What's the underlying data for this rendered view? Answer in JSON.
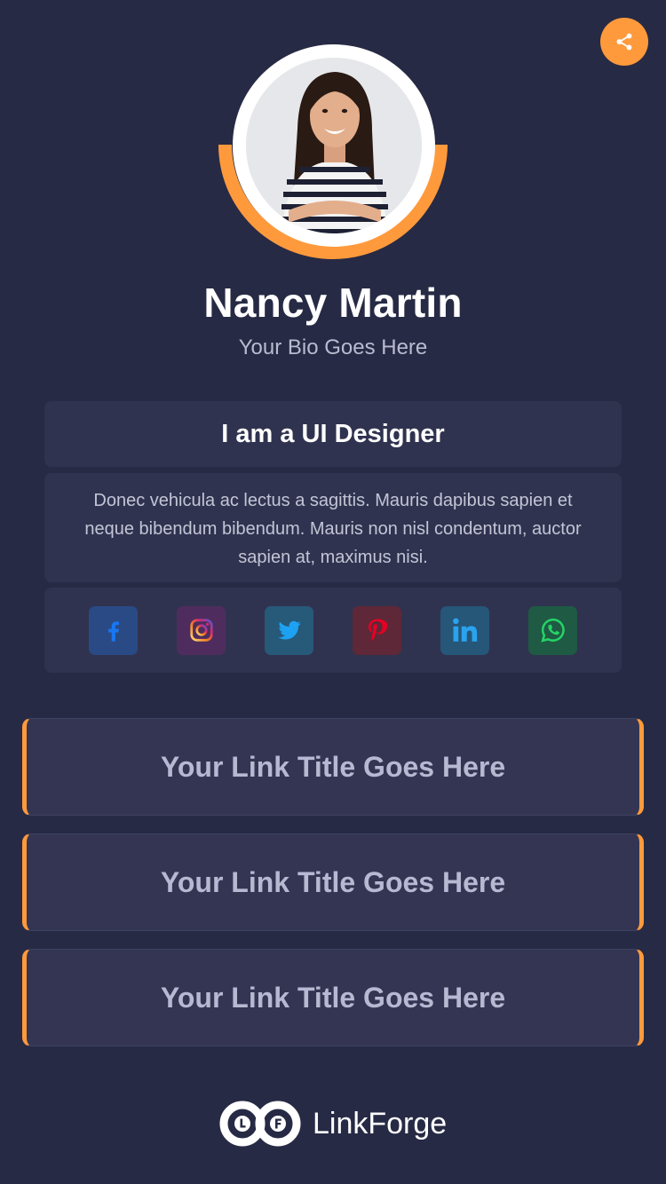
{
  "profile": {
    "name": "Nancy Martin",
    "bio": "Your Bio Goes Here"
  },
  "about": {
    "title": "I am a UI Designer",
    "description": "Donec vehicula ac lectus a sagittis. Mauris dapibus sapien et neque bibendum bibendum. Mauris non nisl condentum, auctor sapien at, maximus nisi."
  },
  "social": [
    {
      "name": "facebook-icon",
      "color": "#1877f2"
    },
    {
      "name": "instagram-icon",
      "color": "#c13584"
    },
    {
      "name": "twitter-icon",
      "color": "#1da1f2"
    },
    {
      "name": "pinterest-icon",
      "color": "#e60023"
    },
    {
      "name": "linkedin-icon",
      "color": "#0a66c2"
    },
    {
      "name": "whatsapp-icon",
      "color": "#25d366"
    }
  ],
  "links": [
    {
      "label": "Your Link Title Goes Here"
    },
    {
      "label": "Your Link Title Goes Here"
    },
    {
      "label": "Your Link Title Goes Here"
    }
  ],
  "footer": {
    "brand": "LinkForge"
  },
  "colors": {
    "background": "#272a44",
    "card": "#30334f",
    "accent": "#ff9a3c"
  }
}
